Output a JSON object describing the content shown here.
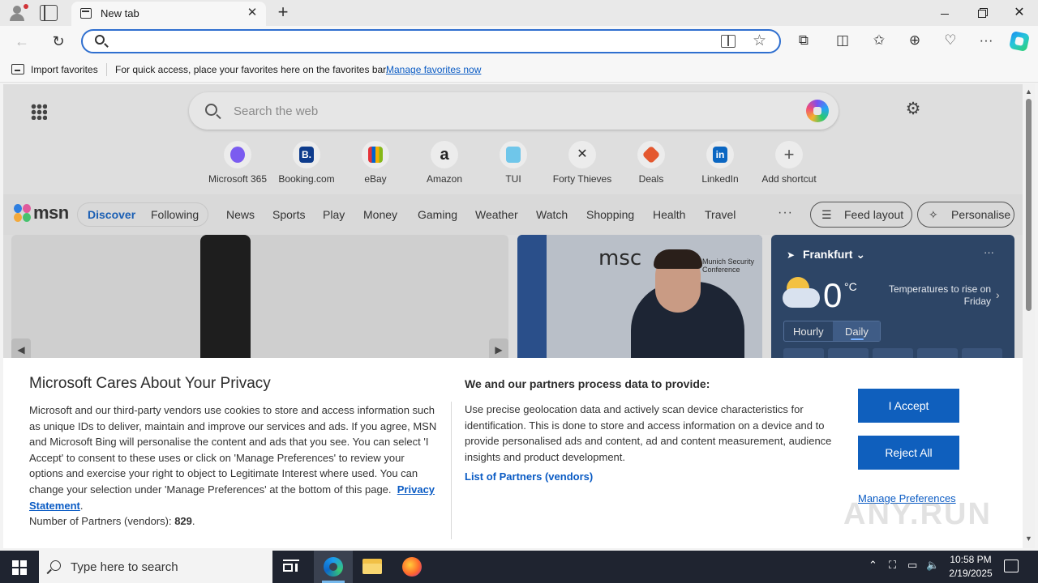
{
  "browser": {
    "tab_title": "New tab",
    "close_tab_glyph": "✕",
    "new_tab_glyph": "+",
    "address_value": "",
    "icons": [
      "back-icon",
      "refresh-icon",
      "search-icon",
      "immersive-reader-icon",
      "favorite-star-icon",
      "extensions-icon",
      "split-screen-icon",
      "favorites-icon",
      "collections-icon",
      "browser-essentials-icon",
      "more-icon",
      "copilot-icon"
    ]
  },
  "favorites_bar": {
    "import_label": "Import favorites",
    "hint_text": "For quick access, place your favorites here on the favorites bar.",
    "manage_link": "Manage favorites now"
  },
  "msn": {
    "search_placeholder": "Search the web",
    "shortcuts": [
      {
        "label": "Microsoft 365",
        "glyph": "",
        "color": "#7b5cf0"
      },
      {
        "label": "Booking.com",
        "glyph": "B.",
        "color": "#0d3b8c"
      },
      {
        "label": "eBay",
        "glyph": "",
        "color": "#2a2a2a"
      },
      {
        "label": "Amazon",
        "glyph": "a",
        "color": "#222222"
      },
      {
        "label": "TUI",
        "glyph": "",
        "color": "#6fc6ea"
      },
      {
        "label": "Forty Thieves",
        "glyph": "✕",
        "color": "#2a2a2a"
      },
      {
        "label": "Deals",
        "glyph": "",
        "color": "#e4572e"
      },
      {
        "label": "LinkedIn",
        "glyph": "in",
        "color": "#0a66c2"
      },
      {
        "label": "Add shortcut",
        "glyph": "+",
        "color": "#555555"
      }
    ],
    "logo_text": "msn",
    "feed_toggle": {
      "active": "Discover",
      "inactive": "Following"
    },
    "categories": [
      "News",
      "Sports",
      "Play",
      "Money",
      "Gaming",
      "Weather",
      "Watch",
      "Shopping",
      "Health",
      "Travel"
    ],
    "more_glyph": "···",
    "feed_layout_label": "Feed layout",
    "personalise_label": "Personalise",
    "news_card": {
      "logo": "msc",
      "caption_line1": "Munich Security",
      "caption_line2": "Conference"
    },
    "weather": {
      "location": "Frankfurt",
      "temperature": "0",
      "unit": "°C",
      "note": "Temperatures to rise on Friday",
      "tab_hourly": "Hourly",
      "tab_daily": "Daily",
      "active_tab": "Daily"
    }
  },
  "privacy": {
    "title": "Microsoft Cares About Your Privacy",
    "body": "Microsoft and our third-party vendors use cookies to store and access information such as unique IDs to deliver, maintain and improve our services and ads. If you agree, MSN and Microsoft Bing will personalise the content and ads that you see. You can select 'I Accept' to consent to these uses or click on 'Manage Preferences' to review your options and exercise your right to object to Legitimate Interest where used.  You can change your selection under 'Manage Preferences' at the bottom of this page.",
    "privacy_link": "Privacy Statement",
    "partners_label": "Number of Partners (vendors):",
    "partners_count": "829",
    "subtitle": "We and our partners process data to provide:",
    "subbody": "Use precise geolocation data and actively scan device characteristics for identification. This is done to store and access information on a device and to provide personalised ads and content, ad and content measurement, audience insights and product development.",
    "partners_link": "List of Partners (vendors)",
    "accept_label": "I Accept",
    "reject_label": "Reject All",
    "manage_label": "Manage Preferences",
    "accent_color": "#0f5fbd"
  },
  "watermark": "ANY.RUN",
  "taskbar": {
    "search_placeholder": "Type here to search",
    "time": "10:58 PM",
    "date": "2/19/2025"
  }
}
